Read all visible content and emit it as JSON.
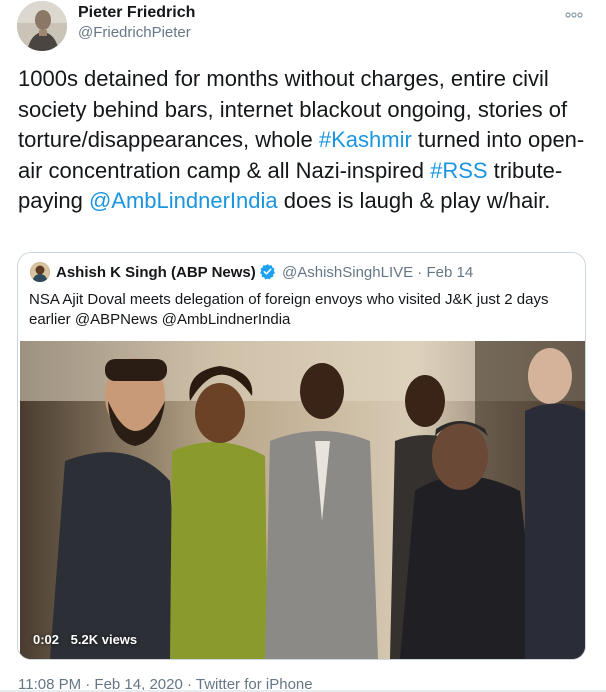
{
  "author": {
    "name": "Pieter Friedrich",
    "handle": "@FriedrichPieter"
  },
  "tweet": {
    "text_1": "1000s detained for months without charges, entire civil society behind bars, internet blackout ongoing, stories of torture/disappearances, whole ",
    "hashtag_1": "#Kashmir",
    "text_2": " turned into open-air concentration camp & all Nazi-inspired ",
    "hashtag_2": "#RSS",
    "text_3": " tribute-paying ",
    "mention_1": "@AmbLindnerIndia",
    "text_4": " does is laugh & play w/hair."
  },
  "quoted": {
    "name": "Ashish K Singh (ABP News)",
    "handle_date": "@AshishSinghLIVE · Feb 14",
    "text": "NSA Ajit Doval meets delegation of foreign envoys who visited J&K just 2 days earlier @ABPNews @AmbLindnerIndia",
    "video": {
      "time": "0:02",
      "views": "5.2K views"
    }
  },
  "footer": {
    "meta": "11:08 PM · Feb 14, 2020 · Twitter for iPhone"
  },
  "icons": {
    "more": "more-icon",
    "verified": "verified-badge-icon"
  },
  "colors": {
    "link": "#1b95e0",
    "secondary_text": "#657786",
    "border": "#ccd6dd"
  }
}
